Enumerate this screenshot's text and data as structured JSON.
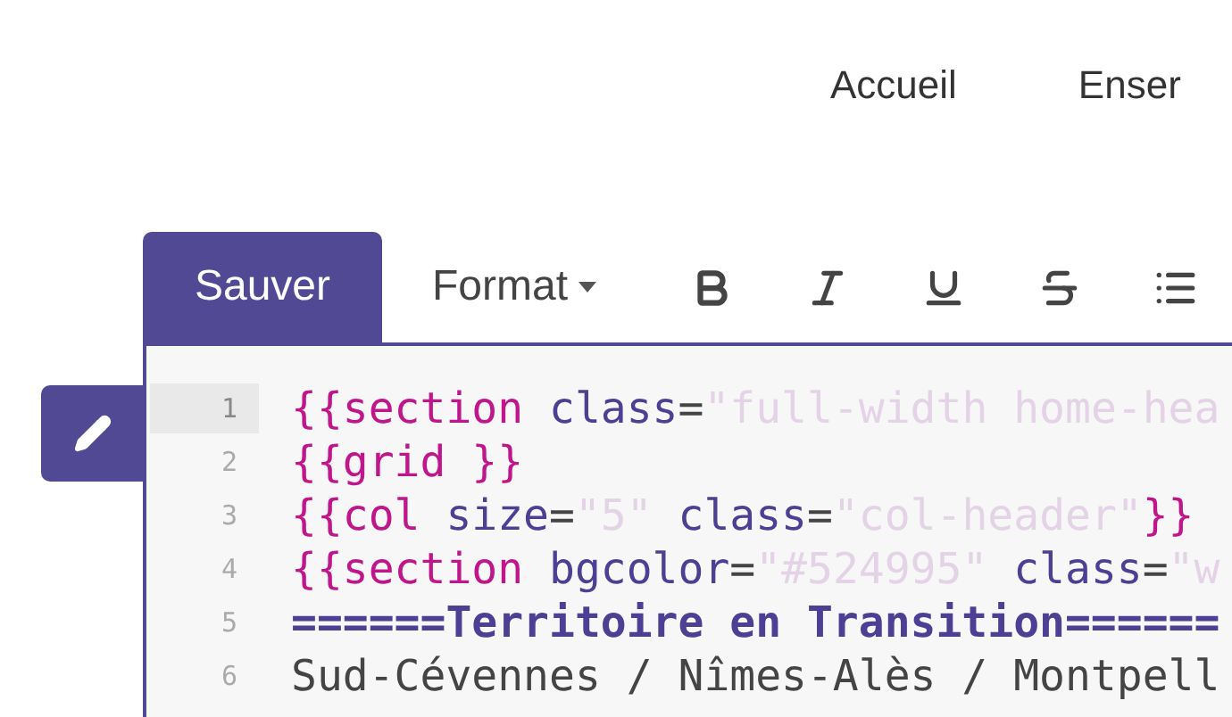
{
  "nav": [
    {
      "label": "Accueil"
    },
    {
      "label": "Enser"
    }
  ],
  "toolbar": {
    "save": "Sauver",
    "format": "Format"
  },
  "editor": {
    "lines": [
      {
        "number": "1",
        "active": true,
        "tokens": [
          {
            "kind": "tag",
            "text": "{{section"
          },
          {
            "kind": "attr",
            "text": " class"
          },
          {
            "kind": "punct",
            "text": "="
          },
          {
            "kind": "string",
            "text": "\"full-width home-hea"
          }
        ]
      },
      {
        "number": "2",
        "active": false,
        "tokens": [
          {
            "kind": "tag",
            "text": "{{grid }}"
          }
        ]
      },
      {
        "number": "3",
        "active": false,
        "tokens": [
          {
            "kind": "tag",
            "text": "{{col"
          },
          {
            "kind": "attr",
            "text": " size"
          },
          {
            "kind": "punct",
            "text": "="
          },
          {
            "kind": "string",
            "text": "\"5\""
          },
          {
            "kind": "attr",
            "text": " class"
          },
          {
            "kind": "punct",
            "text": "="
          },
          {
            "kind": "string",
            "text": "\"col-header\""
          },
          {
            "kind": "tag",
            "text": "}}"
          }
        ]
      },
      {
        "number": "4",
        "active": false,
        "tokens": [
          {
            "kind": "tag",
            "text": "{{section"
          },
          {
            "kind": "attr",
            "text": " bgcolor"
          },
          {
            "kind": "punct",
            "text": "="
          },
          {
            "kind": "string",
            "text": "\"#524995\""
          },
          {
            "kind": "attr",
            "text": " class"
          },
          {
            "kind": "punct",
            "text": "="
          },
          {
            "kind": "string",
            "text": "\"w"
          }
        ]
      },
      {
        "number": "5",
        "active": false,
        "tokens": [
          {
            "kind": "heading",
            "text": "======Territoire en Transition======"
          }
        ]
      },
      {
        "number": "6",
        "active": false,
        "tokens": [
          {
            "kind": "text",
            "text": "Sud-Cévennes / Nîmes-Alès / Montpell"
          }
        ]
      }
    ]
  }
}
